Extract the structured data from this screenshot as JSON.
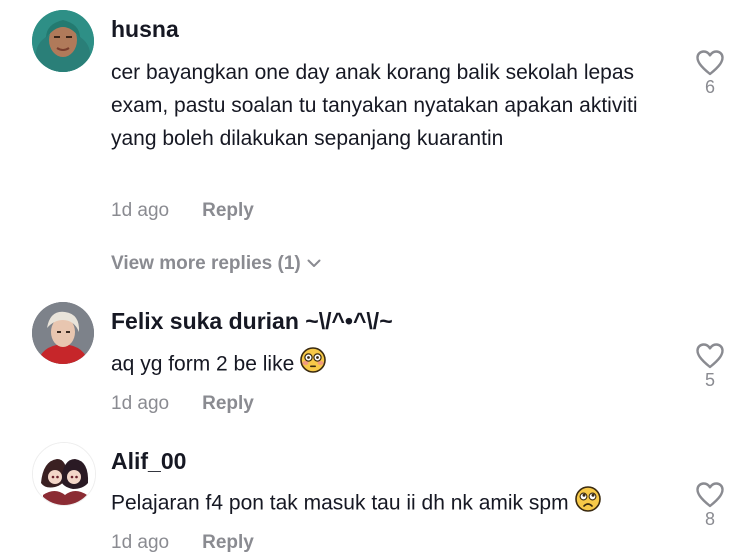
{
  "comments": [
    {
      "username": "husna",
      "text": "cer bayangkan one day anak korang balik sekolah lepas exam, pastu soalan tu tanyakan nyatakan apakan aktiviti yang boleh dilakukan sepanjang kuarantin",
      "time": "1d ago",
      "reply_label": "Reply",
      "likes": "6"
    },
    {
      "username": "Felix suka durian ~\\/^•^\\/~",
      "text": "aq yg form 2 be like",
      "emoji": "flushed-face-emoji",
      "time": "1d ago",
      "reply_label": "Reply",
      "likes": "5"
    },
    {
      "username": "Alif_00",
      "text": "Pelajaran f4 pon tak masuk tau ii dh nk amik spm",
      "emoji": "pleading-face-emoji",
      "time": "1d ago",
      "reply_label": "Reply",
      "likes": "8"
    }
  ],
  "view_more_label": "View more replies (1)",
  "colors": {
    "text": "#161823",
    "muted": "#8a8b91",
    "background": "#ffffff"
  }
}
